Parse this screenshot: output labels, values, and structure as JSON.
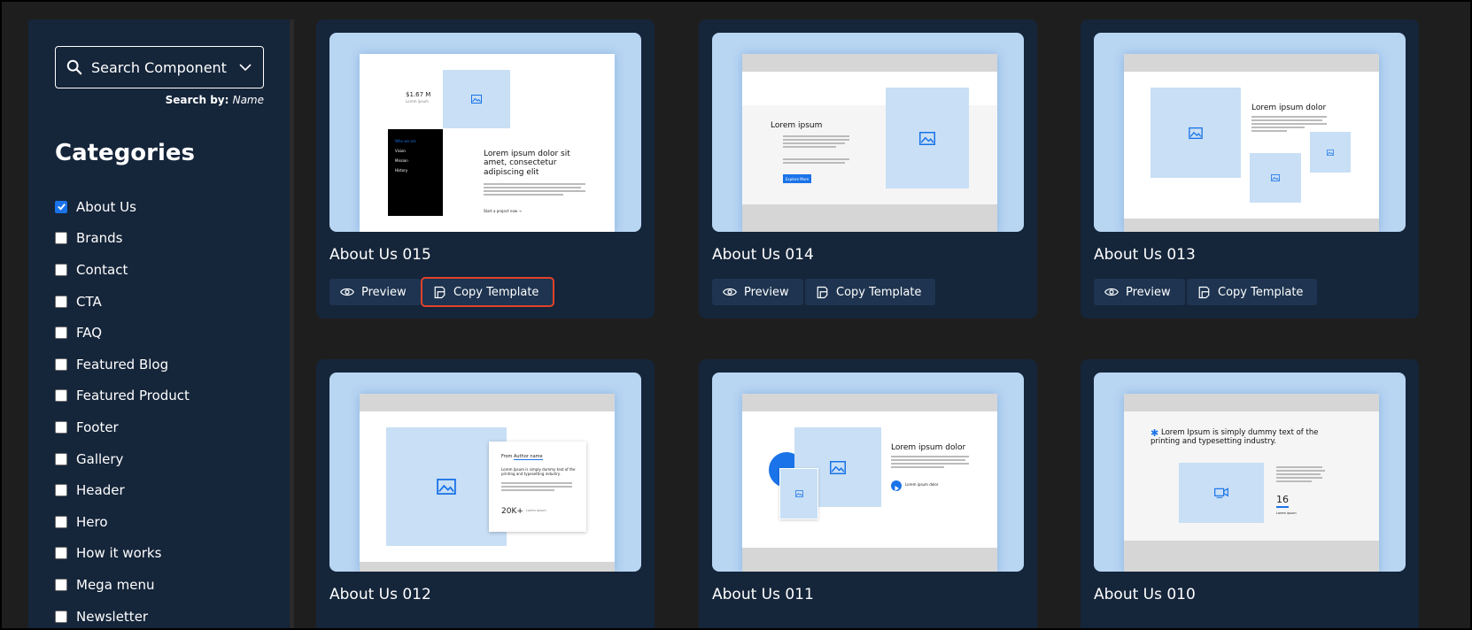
{
  "sidebar": {
    "search_label": "Search Component",
    "search_by_prefix": "Search by:",
    "search_by_value": "Name",
    "categories_title": "Categories",
    "categories": [
      {
        "label": "About Us",
        "checked": true
      },
      {
        "label": "Brands",
        "checked": false
      },
      {
        "label": "Contact",
        "checked": false
      },
      {
        "label": "CTA",
        "checked": false
      },
      {
        "label": "FAQ",
        "checked": false
      },
      {
        "label": "Featured Blog",
        "checked": false
      },
      {
        "label": "Featured Product",
        "checked": false
      },
      {
        "label": "Footer",
        "checked": false
      },
      {
        "label": "Gallery",
        "checked": false
      },
      {
        "label": "Header",
        "checked": false
      },
      {
        "label": "Hero",
        "checked": false
      },
      {
        "label": "How it works",
        "checked": false
      },
      {
        "label": "Mega menu",
        "checked": false
      },
      {
        "label": "Newsletter",
        "checked": false
      }
    ]
  },
  "buttons": {
    "preview": "Preview",
    "copy": "Copy Template"
  },
  "cards": [
    {
      "name": "About Us 015"
    },
    {
      "name": "About Us 014"
    },
    {
      "name": "About Us 013"
    },
    {
      "name": "About Us 012"
    },
    {
      "name": "About Us 011"
    },
    {
      "name": "About Us 010"
    }
  ],
  "thumbs": {
    "t015": {
      "stat": "$1.67 M",
      "stat_sub": "Lorem ipsum",
      "menu": [
        "Who we are",
        "Vision",
        "Mission",
        "History"
      ],
      "heading": "Lorem ipsum dolor sit amet, consectetur adipiscing elit",
      "link": "Start a project now →"
    },
    "t014": {
      "heading": "Lorem ipsum",
      "button": "Explore More"
    },
    "t013": {
      "heading": "Lorem ipsum dolor"
    },
    "t012": {
      "author_prefix": "From",
      "author": "Author name",
      "heading": "Lorem Ipsum is simply dummy text of the printing and typesetting industry.",
      "stat": "20K+",
      "stat_sub": "Lorem ipsum"
    },
    "t011": {
      "heading": "Lorem ipsum dolor",
      "link": "Lorem ipsum dolor"
    },
    "t010": {
      "heading": "Lorem Ipsum is simply dummy text of the printing and typesetting industry.",
      "stat": "16",
      "stat_sub": "Lorem ipsum"
    }
  },
  "colors": {
    "background": "#1e1e1e",
    "panel": "#15253a",
    "button": "#1e3450",
    "accent": "#1a73e8",
    "highlight": "#e0432a",
    "thumb_bg": "#b8d5f2"
  }
}
